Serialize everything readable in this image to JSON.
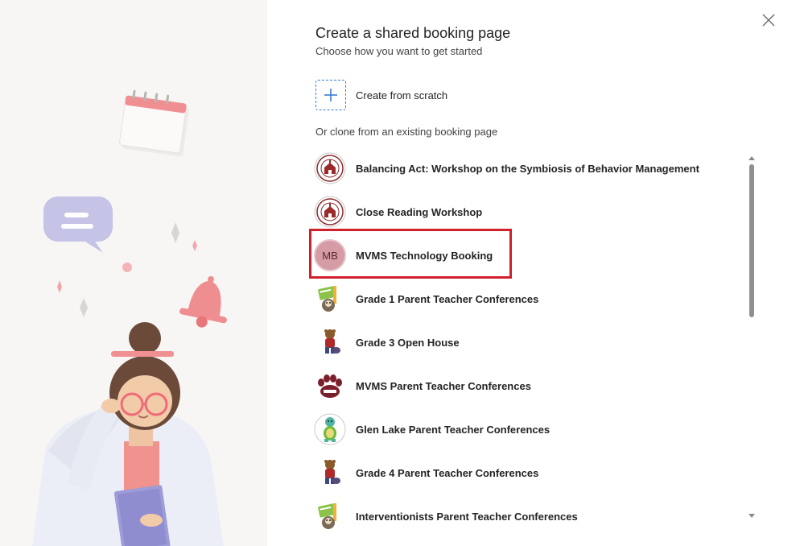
{
  "dialog": {
    "title": "Create a shared booking page",
    "subtitle": "Choose how you want to get started",
    "close_icon": "close-icon"
  },
  "scratch": {
    "label": "Create from scratch",
    "icon": "plus-icon"
  },
  "clone": {
    "heading": "Or clone from an existing booking page",
    "items": [
      {
        "label": "Balancing Act: Workshop on the Symbiosis of Behavior Management",
        "avatar": "school-seal-icon"
      },
      {
        "label": "Close Reading Workshop",
        "avatar": "school-seal-icon"
      },
      {
        "label": "MVMS Technology Booking",
        "avatar_initials": "MB",
        "highlighted": true
      },
      {
        "label": "Grade 1 Parent Teacher Conferences",
        "avatar": "book-mascot-icon"
      },
      {
        "label": "Grade 3 Open House",
        "avatar": "bear-mascot-icon"
      },
      {
        "label": "MVMS Parent Teacher Conferences",
        "avatar": "paw-logo-icon"
      },
      {
        "label": "Glen Lake Parent Teacher Conferences",
        "avatar": "turtle-mascot-icon"
      },
      {
        "label": "Grade 4 Parent Teacher Conferences",
        "avatar": "bear-mascot-icon"
      },
      {
        "label": "Interventionists Parent Teacher Conferences",
        "avatar": "book-mascot-icon"
      }
    ]
  },
  "colors": {
    "accent": "#3b7bd3",
    "highlight_border": "#d0202c",
    "initials_avatar": "#d69ca5",
    "illustration_bg": "#f8f6f4"
  }
}
